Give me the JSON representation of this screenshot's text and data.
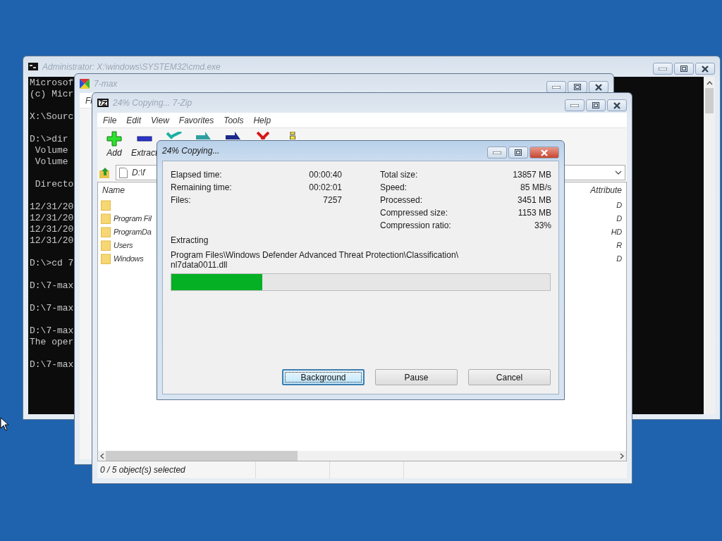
{
  "console_window": {
    "title": "Administrator: X:\\windows\\SYSTEM32\\cmd.exe",
    "blocks": [
      [
        "Microsof",
        "(c) Micr"
      ],
      [
        "X:\\Sourc"
      ],
      [
        "D:\\>dir",
        " Volume",
        " Volume"
      ],
      [
        " Directo"
      ],
      [
        "12/31/20",
        "12/31/20",
        "12/31/20",
        "12/31/20"
      ],
      [
        "D:\\>cd 7"
      ],
      [
        "D:\\7-max"
      ],
      [
        "D:\\7-max"
      ],
      [
        "D:\\7-max",
        "The oper"
      ],
      [
        "D:\\7-max"
      ]
    ]
  },
  "background_window": {
    "title": "7-max",
    "menu": [
      "Fi"
    ]
  },
  "main_window": {
    "title": "24% Copying... 7-Zip",
    "menu": [
      "File",
      "Edit",
      "View",
      "Favorites",
      "Tools",
      "Help"
    ],
    "toolbar": [
      {
        "kind": "add",
        "label": "Add"
      },
      {
        "kind": "extract",
        "label": "Extract"
      },
      {
        "kind": "test"
      },
      {
        "kind": "copy"
      },
      {
        "kind": "move"
      },
      {
        "kind": "delete"
      },
      {
        "kind": "info"
      }
    ],
    "path": "D:\\f",
    "columns": [
      "Name",
      "Attribute"
    ],
    "rows": [
      {
        "attributes": "D"
      },
      {
        "name": "Program Fil",
        "attributes": "D"
      },
      {
        "name": "ProgramDa",
        "attributes": "HD"
      },
      {
        "name": "Users",
        "attributes": "R"
      },
      {
        "name": "Windows",
        "attributes": "D"
      }
    ],
    "status_bar": "0 / 5 object(s) selected"
  },
  "dialog": {
    "title": "24% Copying...",
    "stats_left": [
      {
        "label": "Elapsed time:",
        "value": "00:00:40"
      },
      {
        "label": "Remaining time:",
        "value": "00:02:01"
      },
      {
        "label": "Files:",
        "value": "7257"
      }
    ],
    "stats_right": [
      {
        "label": "Total size:",
        "value": "13857 MB"
      },
      {
        "label": "Speed:",
        "value": "85 MB/s"
      },
      {
        "label": "Processed:",
        "value": "3451 MB"
      },
      {
        "label": "Compressed size:",
        "value": "1153 MB"
      },
      {
        "label": "Compression ratio:",
        "value": "33%"
      }
    ],
    "action": "Extracting",
    "current_file": [
      "Program Files\\Windows Defender Advanced Threat Protection\\Classification\\",
      "nl7data0011.dll"
    ],
    "progress": {
      "level": 0.24
    },
    "buttons": [
      {
        "label": "Background",
        "focused": true
      },
      {
        "label": "Pause",
        "focused": false
      },
      {
        "label": "Cancel",
        "focused": false
      }
    ]
  }
}
